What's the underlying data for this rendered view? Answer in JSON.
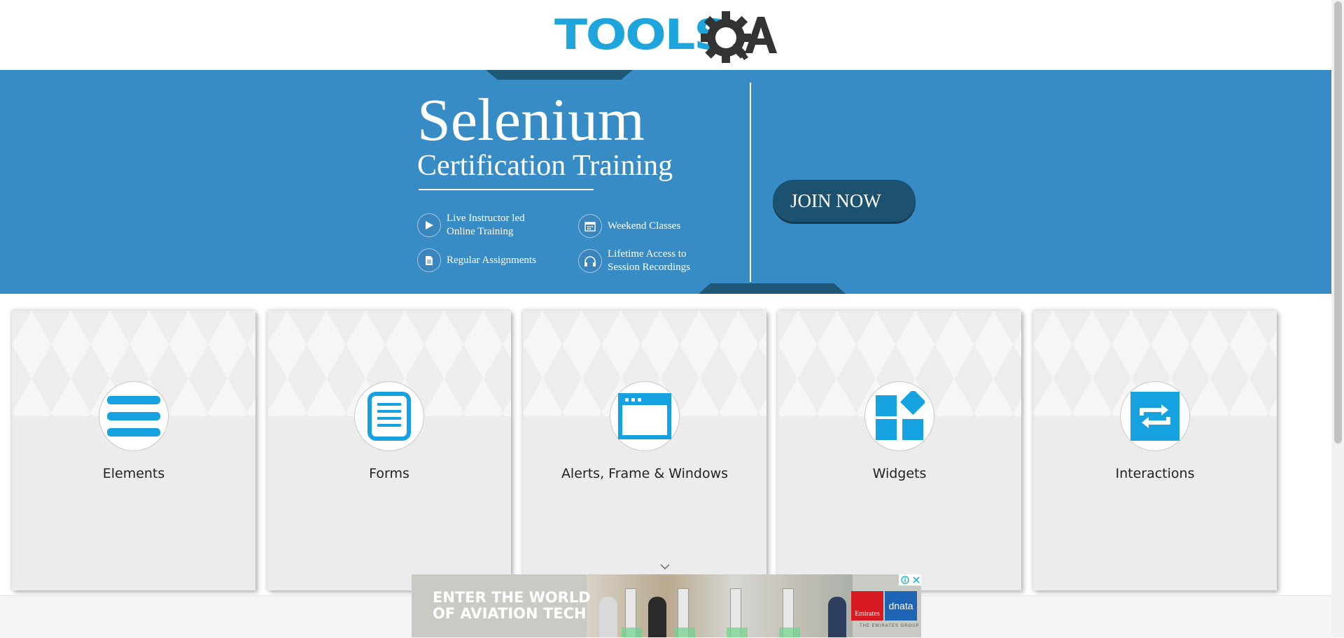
{
  "header": {
    "logo_tools_text": "TOOLS",
    "logo_text_full": "TOOLSQA"
  },
  "banner": {
    "title": "Selenium",
    "subtitle": "Certification Training",
    "features": [
      {
        "icon": "play-icon",
        "label": "Live Instructor led Online Training"
      },
      {
        "icon": "calendar-icon",
        "label": "Weekend Classes"
      },
      {
        "icon": "document-icon",
        "label": "Regular Assignments"
      },
      {
        "icon": "headphones-icon",
        "label": "Lifetime Access to Session Recordings"
      }
    ],
    "join_button": "JOIN NOW"
  },
  "cards": [
    {
      "label": "Elements",
      "icon": "hamburger-icon"
    },
    {
      "label": "Forms",
      "icon": "form-icon"
    },
    {
      "label": "Alerts, Frame & Windows",
      "icon": "browser-window-icon"
    },
    {
      "label": "Widgets",
      "icon": "widgets-icon"
    },
    {
      "label": "Interactions",
      "icon": "repeat-icon"
    }
  ],
  "ad": {
    "headline": "ENTER THE WORLD OF AVIATION TECH",
    "brand_1": "Emirates",
    "brand_2": "dnata",
    "tagline": "THE EMIRATES GROUP"
  },
  "colors": {
    "accent": "#1da5dc",
    "banner_bg": "#388cc5",
    "button_bg": "#1d5170",
    "card_bg": "#ececec"
  }
}
